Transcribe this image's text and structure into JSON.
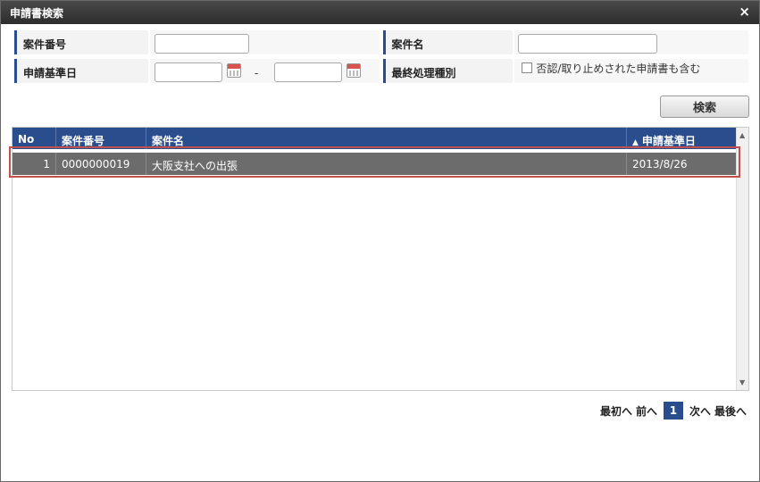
{
  "dialog": {
    "title": "申請書検索",
    "close_label": "×"
  },
  "form": {
    "case_number_label": "案件番号",
    "case_number_value": "",
    "case_name_label": "案件名",
    "case_name_value": "",
    "apply_date_label": "申請基準日",
    "date_from_value": "",
    "date_separator": "-",
    "date_to_value": "",
    "final_process_label": "最終処理種別",
    "include_rejected_label": "否認/取り止めされた申請書も含む",
    "include_rejected_checked": false
  },
  "search_button_label": "検索",
  "table": {
    "columns": [
      "No",
      "案件番号",
      "案件名",
      "申請基準日"
    ],
    "sort_indicator": "▲",
    "rows": [
      {
        "no": "1",
        "case_number": "0000000019",
        "case_name": "大阪支社への出張",
        "apply_date": "2013/8/26"
      }
    ]
  },
  "pager": {
    "first": "最初へ",
    "prev": "前へ",
    "current": "1",
    "next": "次へ",
    "last": "最後へ"
  },
  "colors": {
    "header_bg": "#2a4d8d",
    "selected_row_bg": "#6c6c6c",
    "highlight_border": "#c0504d"
  }
}
